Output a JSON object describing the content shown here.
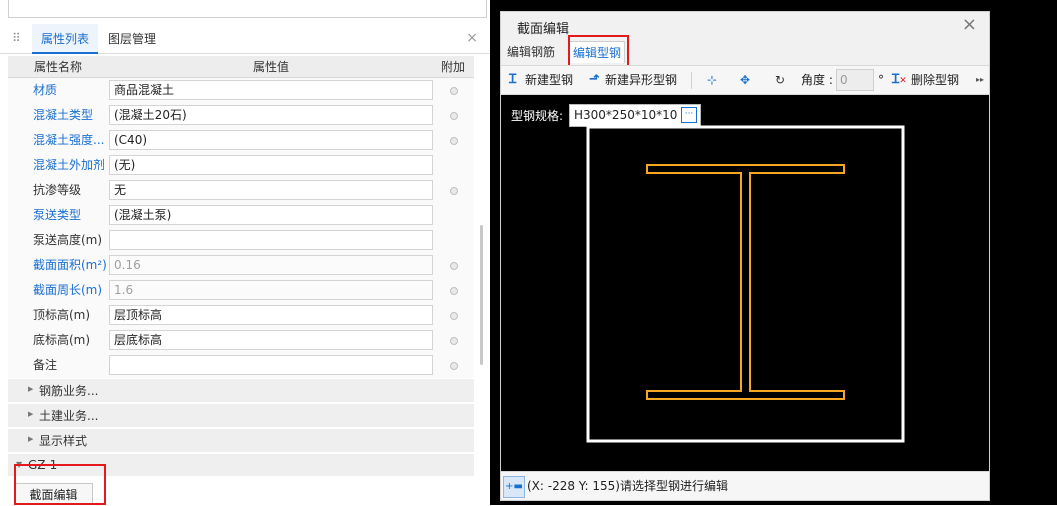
{
  "left_panel": {
    "tabs": {
      "attributes": "属性列表",
      "layers": "图层管理"
    },
    "close_glyph": "×",
    "columns": {
      "name": "属性名称",
      "value": "属性值",
      "extra": "附加"
    },
    "rows": [
      {
        "name": "材质",
        "value": "商品混凝土"
      },
      {
        "name": "混凝土类型",
        "value": "(混凝土20石)"
      },
      {
        "name": "混凝土强度...",
        "value": "(C40)"
      },
      {
        "name": "混凝土外加剂",
        "value": "(无)"
      },
      {
        "name": "抗渗等级",
        "value": "无"
      },
      {
        "name": "泵送类型",
        "value": "(混凝土泵)"
      },
      {
        "name": "泵送高度(m)",
        "value": ""
      },
      {
        "name": "截面面积(m²)",
        "value": "0.16"
      },
      {
        "name": "截面周长(m)",
        "value": "1.6"
      },
      {
        "name": "顶标高(m)",
        "value": "层顶标高"
      },
      {
        "name": "底标高(m)",
        "value": "层底标高"
      },
      {
        "name": "备注",
        "value": ""
      }
    ],
    "groups": [
      "钢筋业务...",
      "土建业务...",
      "显示样式"
    ],
    "component_group": "GZ-1",
    "section_edit_button": "截面编辑"
  },
  "dialog": {
    "title": "截面编辑",
    "close_glyph": "×",
    "tabs": {
      "edit_rebar": "编辑钢筋",
      "edit_steel": "编辑型钢"
    },
    "toolbar": {
      "new_steel": "新建型钢",
      "new_irregular_steel": "新建异形型钢",
      "angle_label": "角度 :",
      "angle_value": "0",
      "angle_unit": "°",
      "delete_steel": "删除型钢",
      "more_glyph": "▸▸"
    },
    "spec_label": "型钢规格:",
    "spec_value": "H300*250*10*10",
    "spec_button_glyph": "···",
    "status_text": "(X: -228 Y: 155)请选择型钢进行编辑",
    "colors": {
      "section_outline": "#ffffff",
      "steel": "#f5a623",
      "accent": "#1a6fd1",
      "highlight": "#e3191c"
    }
  }
}
